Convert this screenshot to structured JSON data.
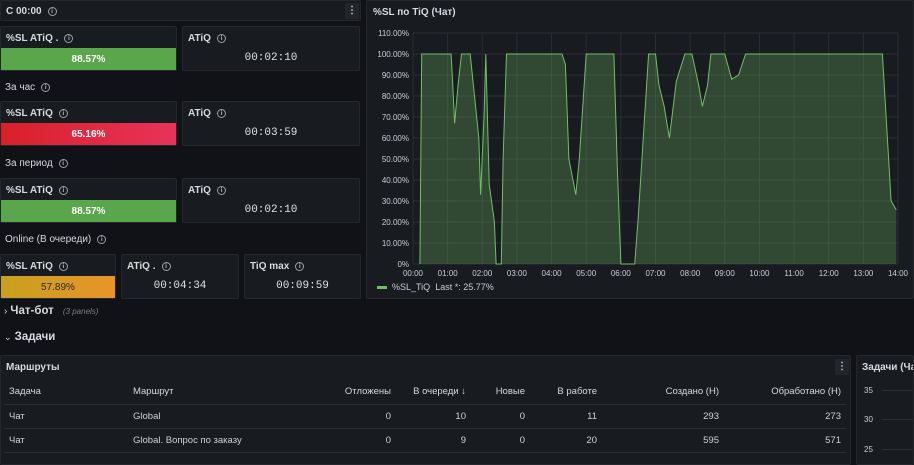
{
  "topbar": {
    "title": "С 00:00"
  },
  "rows": {
    "hour": "За час",
    "period": "За период",
    "online": "Online (В очереди)"
  },
  "stats": {
    "sl1": {
      "title": "%SL ATiQ .",
      "value": "88.57%",
      "fill_pct": 88.57,
      "color": "#5aa64b"
    },
    "atiq1": {
      "title": "ATiQ",
      "value": "00:02:10"
    },
    "sl2": {
      "title": "%SL ATiQ",
      "value": "65.16%",
      "fill_pct": 65.16,
      "color": "#e02f44"
    },
    "atiq2": {
      "title": "ATiQ",
      "value": "00:03:59"
    },
    "sl3": {
      "title": "%SL ATiQ",
      "value": "88.57%",
      "fill_pct": 88.57,
      "color": "#5aa64b"
    },
    "atiq3": {
      "title": "ATiQ",
      "value": "00:02:10"
    },
    "sl4": {
      "title": "%SL ATiQ",
      "value": "57.89%",
      "fill_pct": 57.89,
      "color": "#e0a020"
    },
    "atiq4": {
      "title": "ATiQ .",
      "value": "00:04:34"
    },
    "tiqmax": {
      "title": "TiQ max",
      "value": "00:09:59"
    }
  },
  "chart_panel": {
    "title": "%SL по TiQ (Чат)"
  },
  "chart_data": {
    "type": "area",
    "title": "%SL по TiQ (Чат)",
    "y_ticks": [
      "0%",
      "10.00%",
      "20.00%",
      "30.00%",
      "40.00%",
      "50.00%",
      "60.00%",
      "70.00%",
      "80.00%",
      "90.00%",
      "100.00%",
      "110.00%"
    ],
    "x_ticks": [
      "00:00",
      "01:00",
      "02:00",
      "03:00",
      "04:00",
      "05:00",
      "06:00",
      "07:00",
      "08:00",
      "09:00",
      "10:00",
      "11:00",
      "12:00",
      "13:00",
      "14:00"
    ],
    "ylim": [
      0,
      110
    ],
    "xlim_hours": [
      0,
      14
    ],
    "series": [
      {
        "name": "%SL_TiQ",
        "color": "#73bf69",
        "x": [
          0.2,
          0.25,
          1.0,
          1.1,
          1.15,
          1.2,
          1.3,
          1.4,
          1.55,
          1.65,
          1.9,
          1.95,
          2.05,
          2.1,
          2.2,
          2.35,
          2.4,
          2.55,
          2.6,
          2.7,
          3.0,
          3.5,
          4.0,
          4.3,
          4.4,
          4.5,
          4.7,
          4.8,
          5.0,
          5.2,
          5.5,
          5.55,
          5.8,
          5.9,
          6.0,
          6.2,
          6.3,
          6.4,
          6.5,
          6.8,
          7.0,
          7.1,
          7.25,
          7.4,
          7.6,
          7.85,
          8.05,
          8.25,
          8.35,
          8.5,
          8.6,
          8.8,
          9.0,
          9.2,
          9.4,
          9.6,
          10.0,
          11.0,
          12.0,
          13.0,
          13.3,
          13.5,
          13.55,
          13.8,
          13.95
        ],
        "y": [
          0,
          100,
          100,
          100,
          85,
          67,
          85,
          100,
          100,
          100,
          60,
          33,
          70,
          100,
          38,
          20,
          0,
          0,
          50,
          100,
          100,
          100,
          100,
          100,
          95,
          50,
          33,
          50,
          100,
          100,
          100,
          100,
          100,
          45,
          0,
          0,
          0,
          0,
          22,
          100,
          100,
          85,
          75,
          60,
          87,
          100,
          100,
          85,
          75,
          85,
          100,
          100,
          100,
          88,
          90,
          100,
          100,
          100,
          100,
          100,
          100,
          100,
          100,
          30,
          25.77
        ]
      }
    ],
    "legend": {
      "series": "%SL_TiQ",
      "last_label": "Last *:",
      "last_value": "25.77%"
    },
    "grid": true
  },
  "collapsed_row": {
    "title": "Чат-бот",
    "sub": "(3 panels)"
  },
  "section": {
    "title": "Задачи"
  },
  "table_panel": {
    "title": "Маршруты",
    "columns": [
      "Задача",
      "Маршрут",
      "Отложены",
      "В очереди",
      "Новые",
      "В работе",
      "Создано (Н)",
      "Обработано (Н)"
    ],
    "sort_indicator": "↓",
    "rows": [
      [
        "Чат",
        "Global",
        "0",
        "10",
        "0",
        "11",
        "293",
        "273"
      ],
      [
        "Чат",
        "Global. Вопрос по заказу",
        "0",
        "9",
        "0",
        "20",
        "595",
        "571"
      ]
    ]
  },
  "right_panel": {
    "title": "Задачи (Ча",
    "y_ticks": [
      "35",
      "30",
      "25"
    ]
  }
}
